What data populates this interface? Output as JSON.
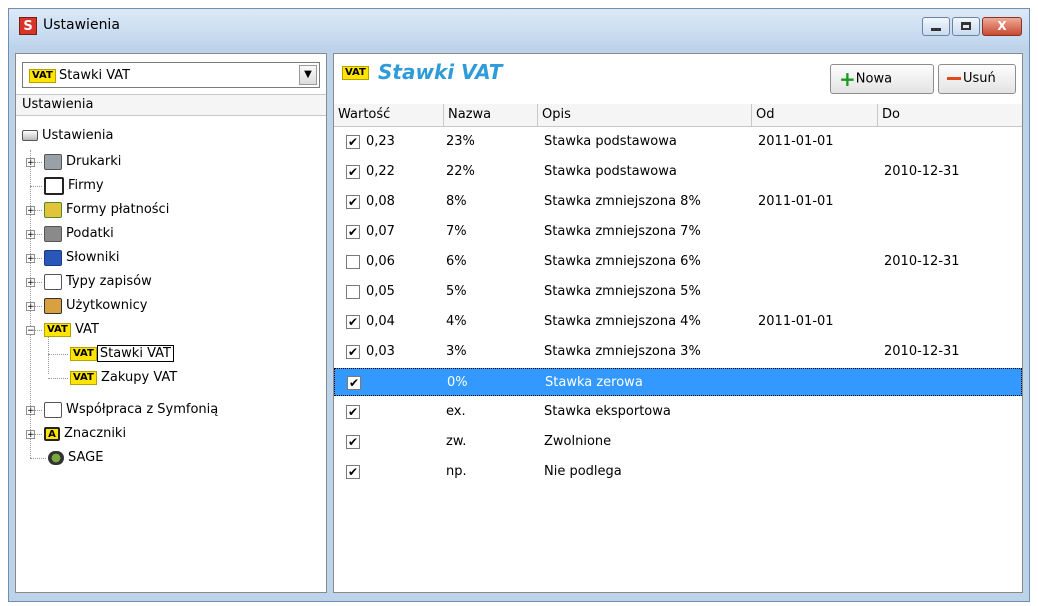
{
  "window": {
    "title": "Ustawienia",
    "app_icon_letter": "S",
    "close_glyph": "X"
  },
  "left": {
    "combo": {
      "badge": "VAT",
      "value": "Stawki VAT"
    },
    "header": "Ustawienia",
    "tree": {
      "root": "Ustawienia",
      "items": [
        {
          "label": "Drukarki"
        },
        {
          "label": "Firmy"
        },
        {
          "label": "Formy płatności"
        },
        {
          "label": "Podatki"
        },
        {
          "label": "Słowniki"
        },
        {
          "label": "Typy zapisów"
        },
        {
          "label": "Użytkownicy"
        },
        {
          "label": "VAT",
          "badge": "VAT"
        },
        {
          "label": "Stawki VAT",
          "badge": "VAT"
        },
        {
          "label": "Zakupy VAT",
          "badge": "VAT"
        },
        {
          "label": "Współpraca z Symfonią"
        },
        {
          "label": "Znaczniki",
          "icon_letter": "A"
        },
        {
          "label": "SAGE"
        }
      ],
      "expand_plus": "+",
      "expand_minus": "−"
    }
  },
  "right": {
    "badge": "VAT",
    "title": "Stawki VAT",
    "buttons": {
      "new": "Nowa",
      "delete": "Usuń"
    },
    "columns": [
      "Wartość",
      "Nazwa",
      "Opis",
      "Od",
      "Do"
    ],
    "check_glyph": "✔",
    "rows": [
      {
        "checked": true,
        "value": "0,23",
        "name": "23%",
        "desc": "Stawka podstawowa",
        "from": "2011-01-01",
        "to": ""
      },
      {
        "checked": true,
        "value": "0,22",
        "name": "22%",
        "desc": "Stawka podstawowa",
        "from": "",
        "to": "2010-12-31"
      },
      {
        "checked": true,
        "value": "0,08",
        "name": "8%",
        "desc": "Stawka zmniejszona 8%",
        "from": "2011-01-01",
        "to": ""
      },
      {
        "checked": true,
        "value": "0,07",
        "name": "7%",
        "desc": "Stawka zmniejszona 7%",
        "from": "",
        "to": ""
      },
      {
        "checked": false,
        "value": "0,06",
        "name": "6%",
        "desc": "Stawka zmniejszona 6%",
        "from": "",
        "to": "2010-12-31"
      },
      {
        "checked": false,
        "value": "0,05",
        "name": "5%",
        "desc": "Stawka zmniejszona 5%",
        "from": "",
        "to": ""
      },
      {
        "checked": true,
        "value": "0,04",
        "name": "4%",
        "desc": "Stawka zmniejszona 4%",
        "from": "2011-01-01",
        "to": ""
      },
      {
        "checked": true,
        "value": "0,03",
        "name": "3%",
        "desc": "Stawka zmniejszona 3%",
        "from": "",
        "to": "2010-12-31"
      },
      {
        "checked": true,
        "value": "",
        "name": "0%",
        "desc": "Stawka zerowa",
        "from": "",
        "to": "",
        "selected": true
      },
      {
        "checked": true,
        "value": "",
        "name": "ex.",
        "desc": "Stawka eksportowa",
        "from": "",
        "to": ""
      },
      {
        "checked": true,
        "value": "",
        "name": "zw.",
        "desc": "Zwolnione",
        "from": "",
        "to": ""
      },
      {
        "checked": true,
        "value": "",
        "name": "np.",
        "desc": "Nie podlega",
        "from": "",
        "to": ""
      }
    ]
  },
  "colors": {
    "accent_title": "#2f9bd8",
    "selection": "#3399ff",
    "vat_badge": "#ffe400"
  }
}
